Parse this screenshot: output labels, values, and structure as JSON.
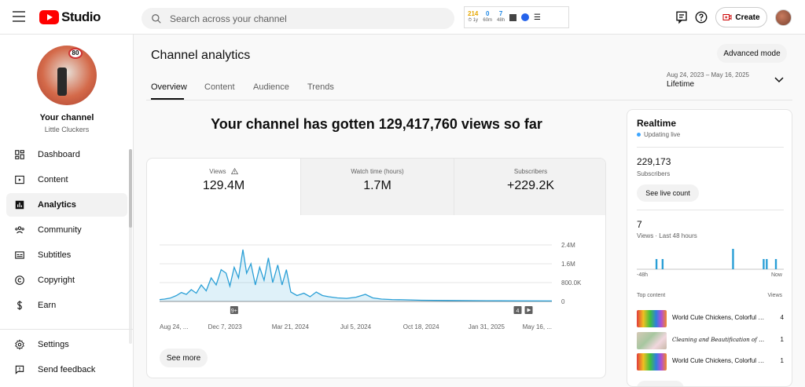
{
  "app": {
    "name": "Studio"
  },
  "search": {
    "placeholder": "Search across your channel"
  },
  "extension": {
    "stats": [
      {
        "value": "214",
        "sub": "1y",
        "color": "#e6a700"
      },
      {
        "value": "0",
        "sub": "60m",
        "color": "#1e88e5"
      },
      {
        "value": "7",
        "sub": "48h",
        "color": "#1e88e5"
      }
    ]
  },
  "header": {
    "create_label": "Create"
  },
  "channel": {
    "title": "Your channel",
    "name": "Little Cluckers",
    "avatar_sign": "80"
  },
  "sidebar": {
    "items": [
      {
        "label": "Dashboard",
        "icon": "dashboard-icon",
        "active": false
      },
      {
        "label": "Content",
        "icon": "content-icon",
        "active": false
      },
      {
        "label": "Analytics",
        "icon": "analytics-icon",
        "active": true
      },
      {
        "label": "Community",
        "icon": "community-icon",
        "active": false
      },
      {
        "label": "Subtitles",
        "icon": "subtitles-icon",
        "active": false
      },
      {
        "label": "Copyright",
        "icon": "copyright-icon",
        "active": false
      },
      {
        "label": "Earn",
        "icon": "earn-icon",
        "active": false
      }
    ],
    "bottom": [
      {
        "label": "Settings",
        "icon": "settings-icon"
      },
      {
        "label": "Send feedback",
        "icon": "feedback-icon"
      }
    ]
  },
  "page": {
    "title": "Channel analytics",
    "advanced_mode": "Advanced mode",
    "tabs": [
      "Overview",
      "Content",
      "Audience",
      "Trends"
    ],
    "active_tab": "Overview",
    "date_range": "Aug 24, 2023 – May 16, 2025",
    "date_label": "Lifetime",
    "headline": "Your channel has gotten 129,417,760 views so far"
  },
  "metrics": [
    {
      "label": "Views",
      "value": "129.4M",
      "warning": true,
      "active": true
    },
    {
      "label": "Watch time (hours)",
      "value": "1.7M",
      "warning": false,
      "active": false
    },
    {
      "label": "Subscribers",
      "value": "+229.2K",
      "warning": false,
      "active": false
    }
  ],
  "see_more": "See more",
  "chart_data": {
    "type": "area",
    "title": "",
    "xlabel": "",
    "ylabel": "",
    "x_tick_labels": [
      "Aug 24, ...",
      "Dec 7, 2023",
      "Mar 21, 2024",
      "Jul 5, 2024",
      "Oct 18, 2024",
      "Jan 31, 2025",
      "May 16, ..."
    ],
    "y_tick_labels": [
      "2.4M",
      "1.6M",
      "800.0K",
      "0"
    ],
    "ylim": [
      0,
      2400000
    ],
    "color": "#2a9fd6",
    "markers": [
      {
        "label": "9+",
        "date": "2023-12-22"
      },
      {
        "label": "4",
        "date": "2025-03-22"
      }
    ],
    "series": [
      {
        "values_by_date": [
          [
            "2023-08-24",
            80000
          ],
          [
            "2023-09-01",
            100000
          ],
          [
            "2023-09-10",
            140000
          ],
          [
            "2023-09-20",
            250000
          ],
          [
            "2023-09-28",
            380000
          ],
          [
            "2023-10-06",
            300000
          ],
          [
            "2023-10-14",
            500000
          ],
          [
            "2023-10-22",
            350000
          ],
          [
            "2023-10-30",
            700000
          ],
          [
            "2023-11-07",
            450000
          ],
          [
            "2023-11-15",
            1000000
          ],
          [
            "2023-11-23",
            700000
          ],
          [
            "2023-12-01",
            1350000
          ],
          [
            "2023-12-09",
            1200000
          ],
          [
            "2023-12-15",
            650000
          ],
          [
            "2023-12-22",
            1450000
          ],
          [
            "2023-12-29",
            1000000
          ],
          [
            "2024-01-05",
            2200000
          ],
          [
            "2024-01-11",
            1200000
          ],
          [
            "2024-01-18",
            1600000
          ],
          [
            "2024-01-25",
            700000
          ],
          [
            "2024-02-01",
            1450000
          ],
          [
            "2024-02-08",
            900000
          ],
          [
            "2024-02-15",
            1850000
          ],
          [
            "2024-02-22",
            800000
          ],
          [
            "2024-03-01",
            1550000
          ],
          [
            "2024-03-08",
            700000
          ],
          [
            "2024-03-15",
            1350000
          ],
          [
            "2024-03-22",
            400000
          ],
          [
            "2024-04-01",
            250000
          ],
          [
            "2024-04-12",
            350000
          ],
          [
            "2024-04-22",
            200000
          ],
          [
            "2024-05-02",
            400000
          ],
          [
            "2024-05-12",
            250000
          ],
          [
            "2024-05-22",
            200000
          ],
          [
            "2024-06-05",
            150000
          ],
          [
            "2024-06-20",
            130000
          ],
          [
            "2024-07-05",
            180000
          ],
          [
            "2024-07-20",
            300000
          ],
          [
            "2024-08-01",
            150000
          ],
          [
            "2024-08-15",
            100000
          ],
          [
            "2024-09-01",
            80000
          ],
          [
            "2024-09-20",
            70000
          ],
          [
            "2024-10-18",
            50000
          ],
          [
            "2024-12-01",
            40000
          ],
          [
            "2025-01-31",
            30000
          ],
          [
            "2025-03-22",
            25000
          ],
          [
            "2025-05-16",
            20000
          ]
        ]
      }
    ]
  },
  "realtime": {
    "title": "Realtime",
    "status": "Updating live",
    "subscribers_value": "229,173",
    "subscribers_label": "Subscribers",
    "live_button": "See live count",
    "views_value": "7",
    "views_label": "Views · Last 48 hours",
    "axis_left": "-48h",
    "axis_right": "Now",
    "bars_48h": [
      0,
      0,
      0,
      0,
      0,
      0,
      1,
      0,
      1,
      0,
      0,
      0,
      0,
      0,
      0,
      0,
      0,
      0,
      0,
      0,
      0,
      0,
      0,
      0,
      0,
      0,
      0,
      0,
      0,
      0,
      0,
      2,
      0,
      0,
      0,
      0,
      0,
      0,
      0,
      0,
      0,
      1,
      1,
      0,
      0,
      1,
      0,
      0
    ],
    "top_content_label": "Top content",
    "views_column": "Views",
    "top_content": [
      {
        "title": "World Cute Chickens, Colorful Chickens",
        "views": "4",
        "thumb": "rainbow",
        "italic": false
      },
      {
        "title": "Cleaning and Beautification of Chickens",
        "views": "1",
        "thumb": "soft",
        "italic": true
      },
      {
        "title": "World Cute Chickens, Colorful Chickens",
        "views": "1",
        "thumb": "rainbow",
        "italic": false
      }
    ]
  }
}
